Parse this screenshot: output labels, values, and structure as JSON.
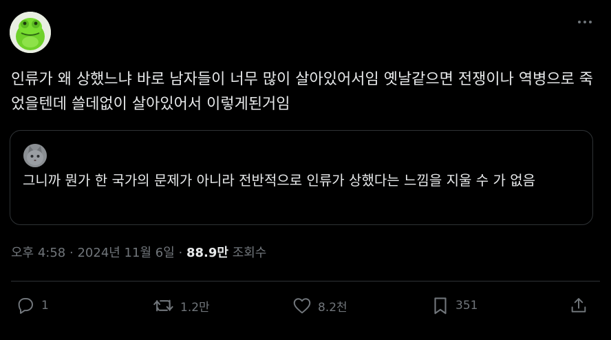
{
  "author": {
    "avatar_icon": "green-frog-avatar"
  },
  "tweet": {
    "text": "인류가 왜 상했느냐 바로 남자들이 너무 많이 살아있어서임 옛날같으면 전쟁이나 역병으로 죽었을텐데 쓸데없이 살아있어서 이렇게된거임"
  },
  "quote": {
    "avatar_icon": "gray-cat-avatar",
    "text": "그니까 뭔가 한 국가의 문제가 아니라 전반적으로 인류가 상했다는 느낌을 지울 수 가 없음"
  },
  "meta": {
    "time": "오후 4:58",
    "sep1": "·",
    "date": "2024년 11월 6일",
    "sep2": "·",
    "views": "88.9만",
    "views_label": "조회수"
  },
  "actions": {
    "reply_count": "1",
    "retweet_count": "1.2만",
    "like_count": "8.2천",
    "bookmark_count": "351"
  },
  "colors": {
    "background": "#000000",
    "text": "#e7e9ea",
    "secondary": "#71767b",
    "border": "#2f3336"
  }
}
